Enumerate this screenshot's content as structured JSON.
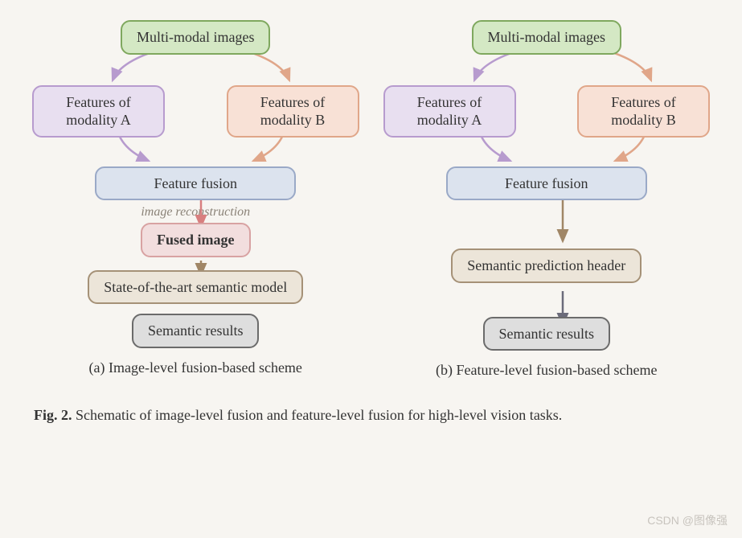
{
  "scheme_a": {
    "multi_modal": "Multi-modal images",
    "feat_a": "Features of modality A",
    "feat_b": "Features of modality B",
    "fusion": "Feature fusion",
    "reconstruction_note": "image reconstruction",
    "fused": "Fused image",
    "sota": "State-of-the-art semantic model",
    "results": "Semantic results",
    "label": "(a) Image-level fusion-based scheme"
  },
  "scheme_b": {
    "multi_modal": "Multi-modal images",
    "feat_a": "Features of modality A",
    "feat_b": "Features of modality B",
    "fusion": "Feature fusion",
    "pred_header": "Semantic prediction header",
    "results": "Semantic results",
    "label": "(b) Feature-level fusion-based scheme"
  },
  "caption_prefix": "Fig. 2.",
  "caption_body": " Schematic of image-level fusion and feature-level fusion for high-level vision tasks.",
  "watermark": "CSDN @图像强",
  "arrow_colors": {
    "purple": "#b79bce",
    "orange": "#e0a689",
    "pink": "#d87f7f",
    "brown": "#a08666",
    "slate": "#6b6b7a"
  }
}
